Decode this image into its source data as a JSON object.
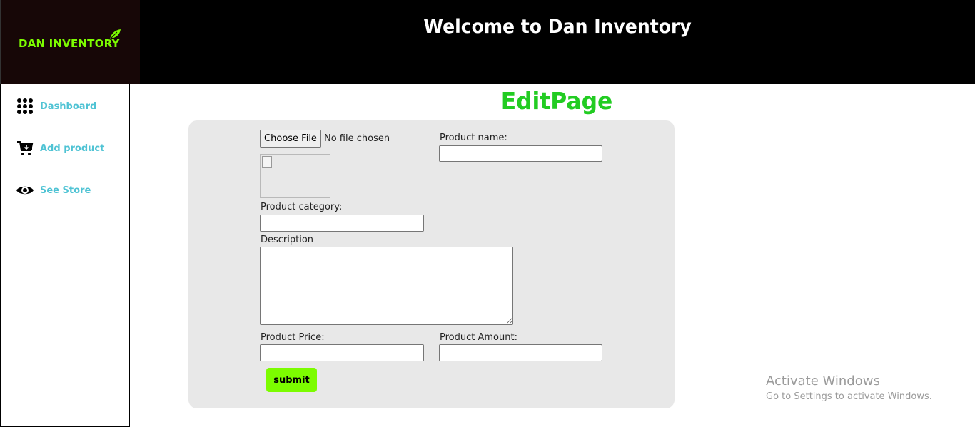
{
  "brand": {
    "logo_text": "DAN INVENTORY",
    "accent": "#7CFC00"
  },
  "header": {
    "title": "Welcome to Dan Inventory"
  },
  "sidebar": {
    "items": [
      {
        "label": "Dashboard",
        "icon": "grid-dots-icon"
      },
      {
        "label": "Add product",
        "icon": "cart-add-icon"
      },
      {
        "label": "See Store",
        "icon": "eye-icon"
      }
    ],
    "link_color": "#4FC3D4"
  },
  "page": {
    "title": "EditPage",
    "title_color": "#22CC22"
  },
  "form": {
    "file_button_label": "Choose File",
    "file_status": "No file chosen",
    "product_name_label": "Product name:",
    "product_name_value": "",
    "category_label": "Product category:",
    "category_value": "",
    "description_label": "Description",
    "description_value": "",
    "price_label": "Product Price:",
    "price_value": "",
    "amount_label": "Product Amount:",
    "amount_value": "",
    "submit_label": "submit"
  },
  "watermark": {
    "line1": "Activate Windows",
    "line2": "Go to Settings to activate Windows."
  }
}
